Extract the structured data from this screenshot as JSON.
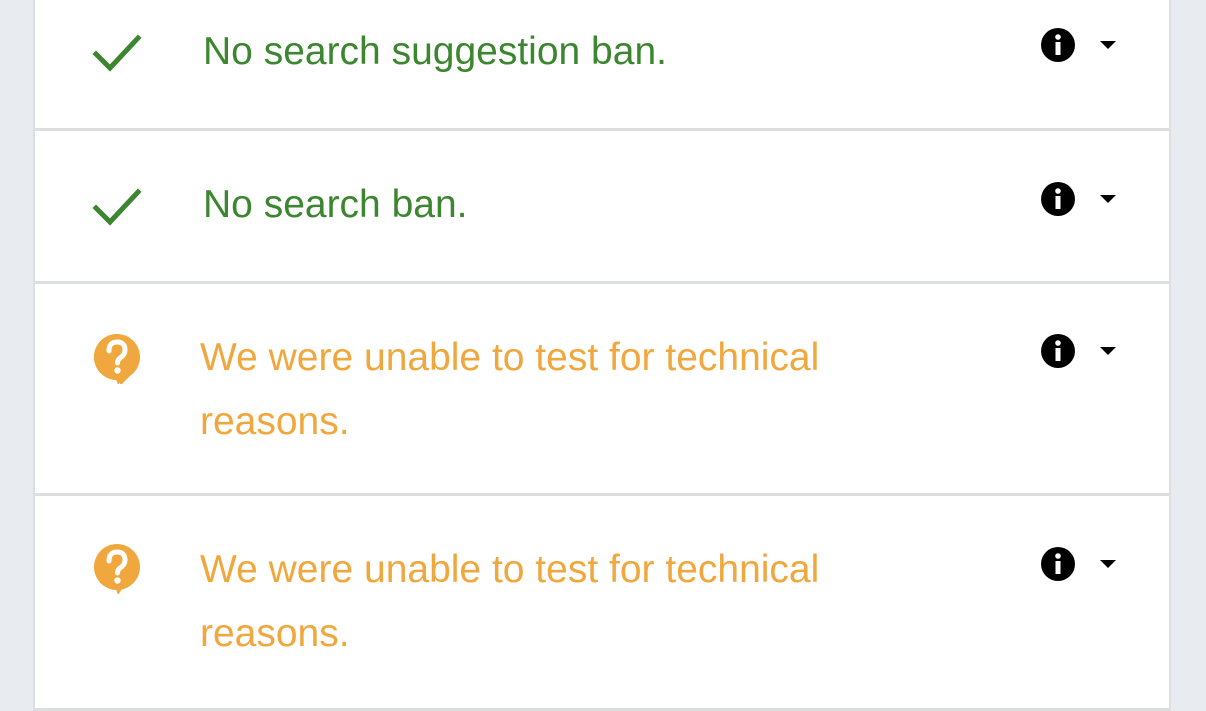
{
  "colors": {
    "ok": "#3b862f",
    "unknown": "#f0a73d",
    "icon": "#000000",
    "divider": "#dcdee1",
    "background": "#e8ebef"
  },
  "results": [
    {
      "status": "ok",
      "status_icon": "checkmark-icon",
      "message": "No search suggestion ban."
    },
    {
      "status": "ok",
      "status_icon": "checkmark-icon",
      "message": "No search ban."
    },
    {
      "status": "unknown",
      "status_icon": "question-bubble-icon",
      "message": "We were unable to test for technical reasons."
    },
    {
      "status": "unknown",
      "status_icon": "question-bubble-icon",
      "message": "We were unable to test for technical reasons."
    }
  ],
  "actions": {
    "info_icon": "info-icon",
    "expand_icon": "caret-down-icon"
  }
}
